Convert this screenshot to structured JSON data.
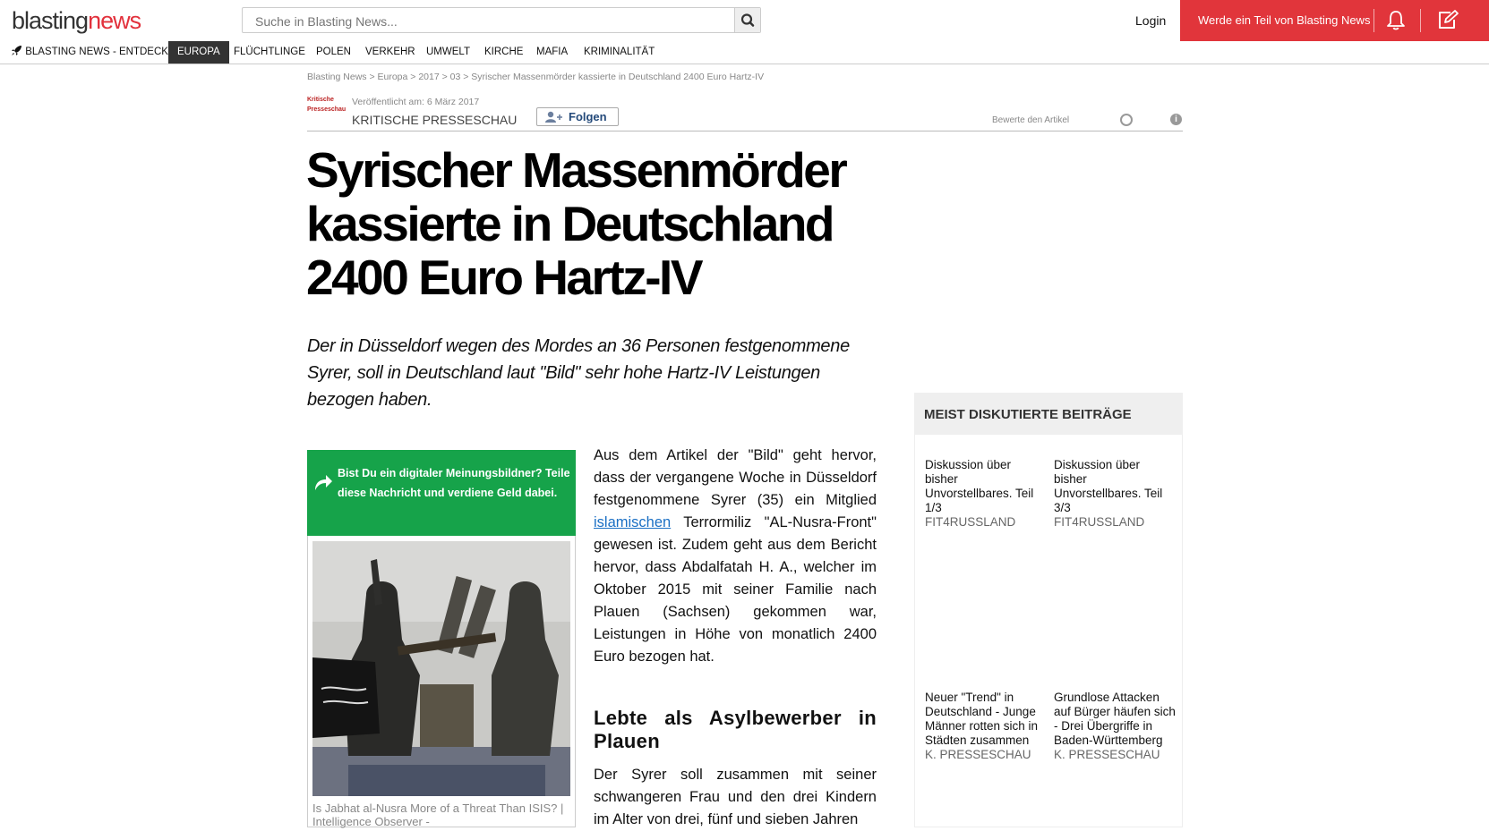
{
  "header": {
    "logo_part1": "blasting",
    "logo_part2": "news",
    "search_placeholder": "Suche in Blasting News...",
    "login": "Login",
    "join": "Werde ein Teil von Blasting News",
    "accent": "#e1353b"
  },
  "nav": {
    "discover": "BLASTING NEWS - ENTDECKE",
    "items": [
      "EUROPA",
      "FLÜCHTLINGE",
      "POLEN",
      "VERKEHR",
      "UMWELT",
      "KIRCHE",
      "MAFIA",
      "KRIMINALITÄT"
    ],
    "active": "EUROPA"
  },
  "breadcrumb": "Blasting News > Europa > 2017 > 03 > Syrischer Massenmörder kassierte in Deutschland 2400 Euro Hartz-IV",
  "author": {
    "logo_text": "Kritische Presseschau",
    "published": "Veröffentlicht am: 6 März 2017",
    "name": "KRITISCHE PRESSESCHAU",
    "follow": "Folgen",
    "rate": "Bewerte den Artikel"
  },
  "article": {
    "title": "Syrischer Massenmörder kassierte in Deutschland 2400 Euro Hartz-IV",
    "subtitle": "Der in Düsseldorf wegen des Mordes an 36 Personen festgenommene Syrer, soll in Deutschland laut \"Bild\" sehr hohe Hartz-IV Leistungen bezogen haben.",
    "share_text": "Bist Du ein digitaler Meinungsbildner? Teile diese Nachricht und verdiene Geld dabei.",
    "image_caption": "Is Jabhat al-Nusra More of a Threat Than ISIS? | Intelligence Observer -",
    "para1_a": "Aus dem Artikel der \"Bild\" geht hervor, dass der vergangene Woche in Düsseldorf festgenommene Syrer (35) ein Mitglied ",
    "para1_link": "islamischen",
    "para1_b": " Terrormiliz \"AL-Nusra-Front\" gewesen ist. Zudem geht aus dem Bericht hervor, dass Abdalfatah H. A., welcher im Oktober 2015 mit seiner Familie nach Plauen (Sachsen) gekommen war, Leistungen in Höhe von monatlich 2400 Euro bezogen hat.",
    "heading2": "Lebte als Asylbewerber in Plauen",
    "para2": "Der Syrer soll zusammen mit seiner schwangeren Frau und den drei Kindern im Alter von drei, fünf und sieben Jahren"
  },
  "sidebar": {
    "heading": "MEIST DISKUTIERTE BEITRÄGE",
    "posts": [
      {
        "title": "Diskussion über bisher Unvorstellbares. Teil 1/3",
        "author": "FIT4RUSSLAND"
      },
      {
        "title": "Diskussion über bisher Unvorstellbares. Teil 3/3",
        "author": "FIT4RUSSLAND"
      },
      {
        "title": "Neuer \"Trend\" in Deutschland - Junge Männer rotten sich in Städten zusammen",
        "author": "K. PRESSESCHAU"
      },
      {
        "title": "Grundlose Attacken auf Bürger häufen sich - Drei Übergriffe in Baden-Württemberg",
        "author": "K. PRESSESCHAU"
      }
    ]
  }
}
